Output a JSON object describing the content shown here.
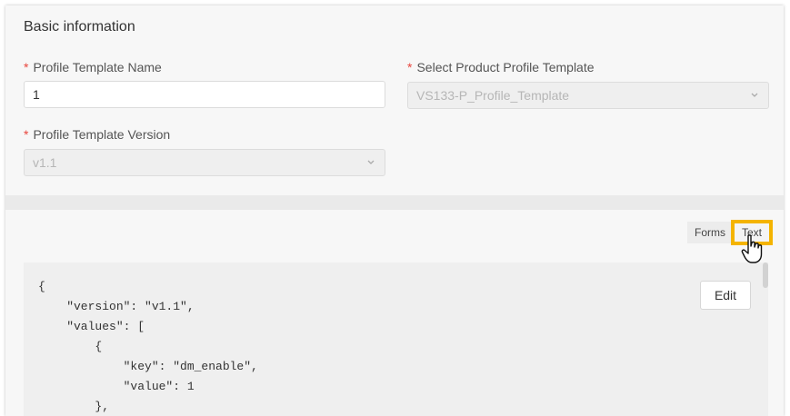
{
  "basic_info": {
    "title": "Basic information",
    "profile_template_name": {
      "label": "Profile Template Name",
      "required_mark": "*",
      "value": "1"
    },
    "product_profile_template": {
      "label": "Select Product Profile Template",
      "required_mark": "*",
      "value": "VS133-P_Profile_Template"
    },
    "profile_template_version": {
      "label": "Profile Template Version",
      "required_mark": "*",
      "value": "v1.1"
    }
  },
  "view_toggle": {
    "forms_label": "Forms",
    "text_label": "Text",
    "active": "Text"
  },
  "editor": {
    "edit_label": "Edit",
    "lines": [
      "{",
      "    \"version\": \"v1.1\",",
      "    \"values\": [",
      "        {",
      "            \"key\": \"dm_enable\",",
      "            \"value\": 1",
      "        },"
    ]
  },
  "colors": {
    "required": "#e8453c",
    "highlight": "#f4b400"
  }
}
